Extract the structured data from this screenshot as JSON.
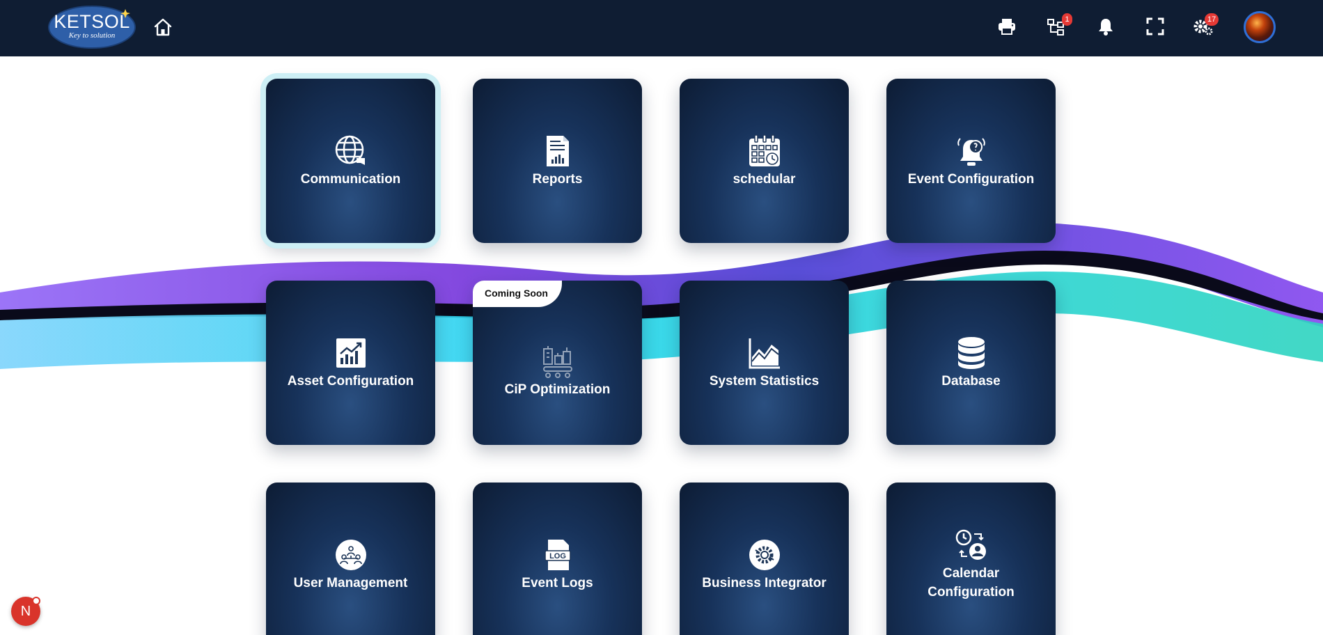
{
  "header": {
    "logo": {
      "name": "KETSOL",
      "tagline": "Key to solution"
    },
    "icons": [
      {
        "name": "printer-icon"
      },
      {
        "name": "hierarchy-icon",
        "badge": "1"
      },
      {
        "name": "bell-icon"
      },
      {
        "name": "fullscreen-icon"
      },
      {
        "name": "settings-icon",
        "badge": "17"
      }
    ]
  },
  "tiles": [
    {
      "label": "Communication",
      "icon": "globe-chat-icon"
    },
    {
      "label": "Reports",
      "icon": "report-icon"
    },
    {
      "label": "schedular",
      "icon": "calendar-icon"
    },
    {
      "label": "Event Configuration",
      "icon": "alarm-bell-icon"
    },
    {
      "label": "Asset Configuration",
      "icon": "growth-chart-icon"
    },
    {
      "label": "CiP Optimization",
      "icon": "factory-icon",
      "ribbon": "Coming Soon"
    },
    {
      "label": "System Statistics",
      "icon": "line-chart-icon"
    },
    {
      "label": "Database",
      "icon": "database-icon"
    },
    {
      "label": "User Management",
      "icon": "users-icon"
    },
    {
      "label": "Event Logs",
      "icon": "log-file-icon"
    },
    {
      "label": "Business Integrator",
      "icon": "gears-icon"
    },
    {
      "label": "Calendar Configuration",
      "icon": "clock-user-icon"
    }
  ],
  "floating_button": {
    "label": "N"
  },
  "colors": {
    "header_bg": "#0f1d33",
    "tile_dark": "#0d1c34",
    "tile_light": "#2a4f80",
    "accent_badge": "#e53935"
  }
}
